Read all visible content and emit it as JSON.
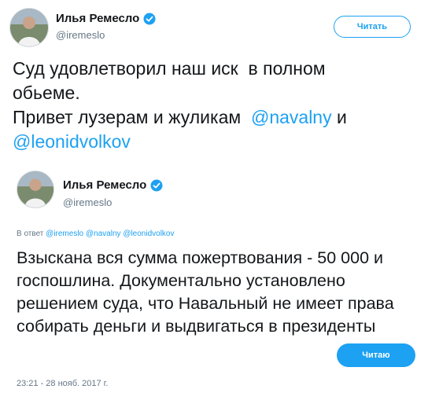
{
  "outer_tweet": {
    "display_name": "Илья Ремесло",
    "handle": "@iremeslo",
    "follow_button": "Читать",
    "text_parts": {
      "line1": "Суд удовлетворил наш иск  в полном",
      "line2": "обьеме.",
      "line3_text": "Привет лузерам и жуликам ",
      "mention1": "@navalny",
      "joiner": " и",
      "mention2": "@leonidvolkov"
    }
  },
  "quoted_tweet": {
    "display_name": "Илья Ремесло",
    "handle": "@iremeslo",
    "following_button": "Читаю",
    "reply_prefix": "В ответ",
    "reply_mentions": [
      "@iremeslo",
      "@navalny",
      "@leonidvolkov"
    ],
    "text": "Взыскана вся сумма пожертвования - 50 000 и госпошлина. Документально установлено решением суда, что Навальный не имеет права собирать деньги и выдвигаться в президенты",
    "timestamp": "23:21 - 28 нояб. 2017 г."
  },
  "icons": {
    "verified": "verified-badge-icon",
    "avatar": "avatar-photo"
  },
  "colors": {
    "accent": "#1da1f2",
    "text": "#14171a",
    "muted": "#657786"
  }
}
